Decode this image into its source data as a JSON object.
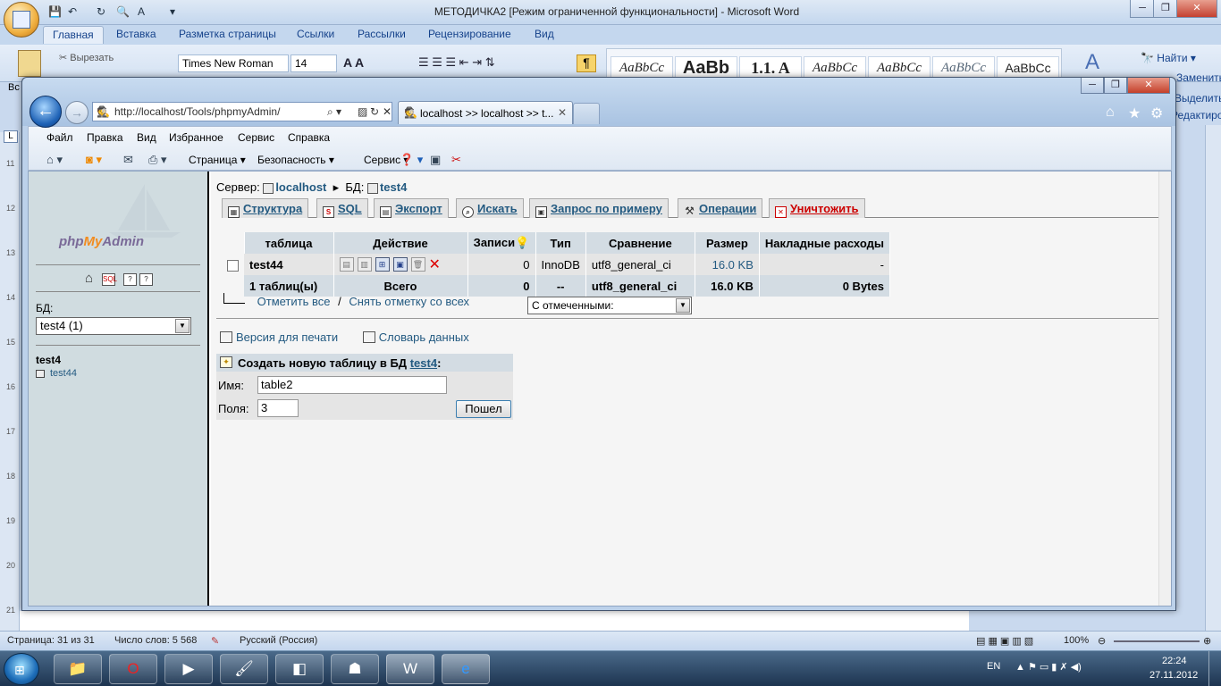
{
  "word": {
    "title": "МЕТОДИЧКА2 [Режим ограниченной функциональности] - Microsoft Word",
    "tabs": [
      "Главная",
      "Вставка",
      "Разметка страницы",
      "Ссылки",
      "Рассылки",
      "Рецензирование",
      "Вид"
    ],
    "ribbon": {
      "cut": "Вырезать",
      "font": "Times New Roman",
      "size": "14",
      "styles": [
        "AaBbCc",
        "AaBb",
        "1.1. A",
        "AaBbCc",
        "AaBbCc",
        "AaBbCc",
        "AaBbCc"
      ],
      "find": "Найти",
      "replace": "Заменить",
      "select": "Выделить",
      "editing": "Редактирование",
      "paste_label": "Вс"
    },
    "status": {
      "page": "Страница: 31 из 31",
      "words": "Число слов: 5 568",
      "lang": "Русский (Россия)",
      "zoom": "100%"
    }
  },
  "taskbar": {
    "lang": "EN",
    "time": "22:24",
    "date": "27.11.2012"
  },
  "ie": {
    "address": "http://localhost/Tools/phpmyAdmin/",
    "tab_title": "localhost >> localhost >> t...",
    "menu": [
      "Файл",
      "Правка",
      "Вид",
      "Избранное",
      "Сервис",
      "Справка"
    ],
    "commands": {
      "page": "Страница",
      "safety": "Безопасность",
      "tools": "Сервис"
    }
  },
  "pma": {
    "logo_php": "php",
    "logo_my": "My",
    "logo_admin": "Admin",
    "db_label": "БД:",
    "db_select": "test4 (1)",
    "left_db": "test4",
    "left_table": "test44",
    "breadcrumb": {
      "server_label": "Сервер:",
      "server": "localhost",
      "db_label": "БД:",
      "db": "test4"
    },
    "tabs": [
      "Структура",
      "SQL",
      "Экспорт",
      "Искать",
      "Запрос по примеру",
      "Операции",
      "Уничтожить"
    ],
    "table": {
      "headers": [
        "таблица",
        "Действие",
        "Записи",
        "Тип",
        "Сравнение",
        "Размер",
        "Накладные расходы"
      ],
      "row": {
        "name": "test44",
        "records": "0",
        "type": "InnoDB",
        "collation": "utf8_general_ci",
        "size": "16.0 KB",
        "overhead": "-"
      },
      "total": {
        "name": "1 таблиц(ы)",
        "label": "Всего",
        "records": "0",
        "type": "--",
        "collation": "utf8_general_ci",
        "size": "16.0 KB",
        "overhead": "0 Bytes"
      }
    },
    "check_all": "Отметить все",
    "separator": "/",
    "uncheck_all": "Снять отметку со всех",
    "with_selected": "С отмеченными:",
    "print_view": "Версия для печати",
    "data_dictionary": "Словарь данных",
    "create": {
      "title": "Создать новую таблицу в БД",
      "db": "test4",
      "name_label": "Имя:",
      "name_value": "table2",
      "fields_label": "Поля:",
      "fields_value": "3",
      "go": "Пошел"
    }
  }
}
